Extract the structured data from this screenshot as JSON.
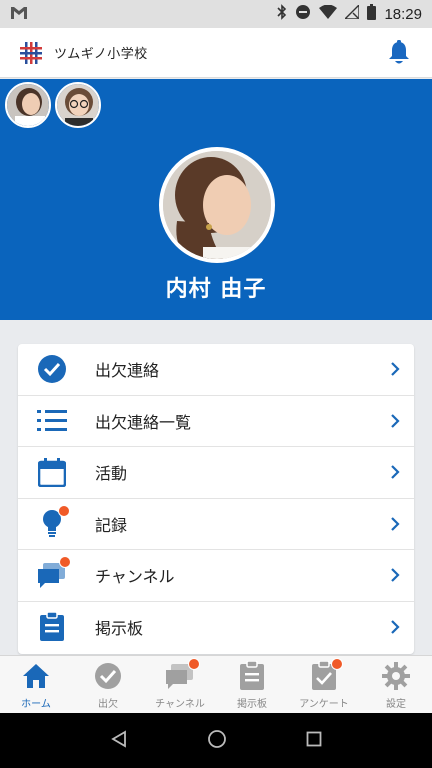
{
  "status_bar": {
    "time": "18:29"
  },
  "header": {
    "school_name": "ツムギノ小学校"
  },
  "profile": {
    "name": "内村 由子"
  },
  "menu": [
    {
      "label": "出欠連絡",
      "icon": "check-circle-icon",
      "badge": false
    },
    {
      "label": "出欠連絡一覧",
      "icon": "list-icon",
      "badge": false
    },
    {
      "label": "活動",
      "icon": "calendar-icon",
      "badge": false
    },
    {
      "label": "記録",
      "icon": "lightbulb-icon",
      "badge": true
    },
    {
      "label": "チャンネル",
      "icon": "chat-icon",
      "badge": true
    },
    {
      "label": "掲示板",
      "icon": "clipboard-icon",
      "badge": false
    }
  ],
  "bottom_nav": [
    {
      "label": "ホーム",
      "icon": "home-icon",
      "active": true
    },
    {
      "label": "出欠",
      "icon": "check-circle-icon",
      "active": false
    },
    {
      "label": "チャンネル",
      "icon": "chat-icon",
      "active": false,
      "badge": true
    },
    {
      "label": "掲示板",
      "icon": "clipboard-icon",
      "active": false
    },
    {
      "label": "アンケート",
      "icon": "survey-icon",
      "active": false,
      "badge": true
    },
    {
      "label": "設定",
      "icon": "gear-icon",
      "active": false
    }
  ],
  "colors": {
    "primary": "#0a64bd",
    "badge": "#f05a28",
    "nav_inactive": "#a0a0a0"
  }
}
